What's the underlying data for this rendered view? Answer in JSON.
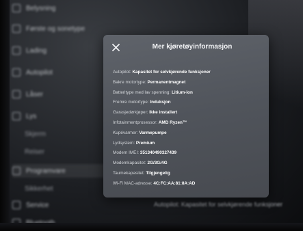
{
  "background_menu": {
    "items": [
      {
        "label": "Belysning",
        "icon": "light-icon",
        "sub": false
      },
      {
        "label": "Første og sonetype",
        "icon": "car-icon",
        "sub": false
      },
      {
        "label": "Lading",
        "icon": "charge-icon",
        "sub": false
      },
      {
        "label": "Autopilot",
        "icon": "steering-icon",
        "sub": false
      },
      {
        "label": "Låser",
        "icon": "lock-icon",
        "sub": false
      },
      {
        "label": "Lys",
        "icon": "bulb-icon",
        "sub": false
      },
      {
        "label": "Skjerm",
        "icon": "",
        "sub": true
      },
      {
        "label": "Reiser",
        "icon": "",
        "sub": true
      },
      {
        "label": "Programvare",
        "icon": "download-icon",
        "sub": false
      },
      {
        "label": "Sikkerhet",
        "icon": "",
        "sub": true
      },
      {
        "label": "Service",
        "icon": "wrench-icon",
        "sub": false
      },
      {
        "label": "Bluetooth",
        "icon": "bluetooth-icon",
        "sub": false
      }
    ],
    "footer_text": "Autopilot: Kapasitet for selvkjørende funksjoner"
  },
  "modal": {
    "title": "Mer kjøretøyinformasjon",
    "close_icon": "close-icon",
    "rows": [
      {
        "key": "Autopilot:",
        "value": "Kapasitet for selvkjørende funksjoner"
      },
      {
        "key": "Bakre motortype:",
        "value": "Permanentmagnet"
      },
      {
        "key": "Batteritype med lav spenning:",
        "value": "Litium-ion"
      },
      {
        "key": "Fremre motortype:",
        "value": "Induksjon"
      },
      {
        "key": "Garasjedørkjøper:",
        "value": "Ikke installert"
      },
      {
        "key": "Infotainmentprosessor:",
        "value": "AMD Ryzen™"
      },
      {
        "key": "Kupévarmer:",
        "value": "Varmepumpe"
      },
      {
        "key": "Lydsystem:",
        "value": "Premium"
      },
      {
        "key": "Modem IMEI:",
        "value": "351340490327439"
      },
      {
        "key": "Modemkapasitet:",
        "value": "2G/3G/4G"
      },
      {
        "key": "Taumekapasitet:",
        "value": "Tilgjengelig"
      },
      {
        "key": "Wi-Fi MAC-adresse:",
        "value": "4C:FC:AA:81:8A:AD"
      }
    ]
  },
  "colors": {
    "modal_bg": "#585c63",
    "text_primary": "#ffffff",
    "text_secondary": "#d3d6da"
  }
}
